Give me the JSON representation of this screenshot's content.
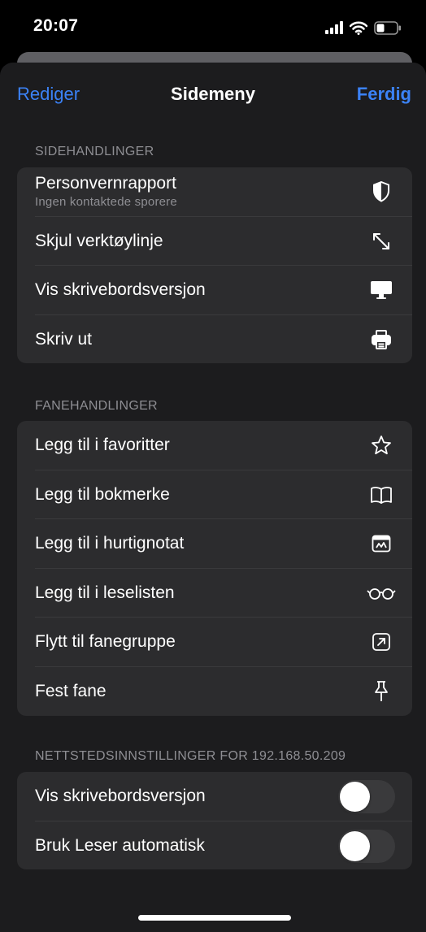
{
  "status_bar": {
    "time": "20:07"
  },
  "nav": {
    "left_label": "Rediger",
    "title": "Sidemeny",
    "right_label": "Ferdig"
  },
  "page_actions": {
    "header": "SIDEHANDLINGER",
    "items": [
      {
        "label": "Personvernrapport",
        "sublabel": "Ingen kontaktede sporere",
        "icon": "shield-icon"
      },
      {
        "label": "Skjul verktøylinje",
        "icon": "arrows-expand-icon"
      },
      {
        "label": "Vis skrivebordsversjon",
        "icon": "desktop-icon"
      },
      {
        "label": "Skriv ut",
        "icon": "printer-icon"
      }
    ]
  },
  "tab_actions": {
    "header": "FANEHANDLINGER",
    "items": [
      {
        "label": "Legg til i favoritter",
        "icon": "star-icon"
      },
      {
        "label": "Legg til bokmerke",
        "icon": "book-icon"
      },
      {
        "label": "Legg til i hurtignotat",
        "icon": "quick-note-icon"
      },
      {
        "label": "Legg til i leselisten",
        "icon": "glasses-icon"
      },
      {
        "label": "Flytt til fanegruppe",
        "icon": "move-to-group-icon"
      },
      {
        "label": "Fest fane",
        "icon": "pin-icon"
      }
    ]
  },
  "site_settings": {
    "header": "NETTSTEDSINNSTILLINGER FOR 192.168.50.209",
    "items": [
      {
        "label": "Vis skrivebordsversjon",
        "toggle_on": false
      },
      {
        "label": "Bruk Leser automatisk",
        "toggle_on": false
      }
    ]
  },
  "colors": {
    "accent": "#3b82f6",
    "sheet": "#1c1c1e",
    "group": "#2c2c2e",
    "secondary_text": "#8e8e93"
  }
}
